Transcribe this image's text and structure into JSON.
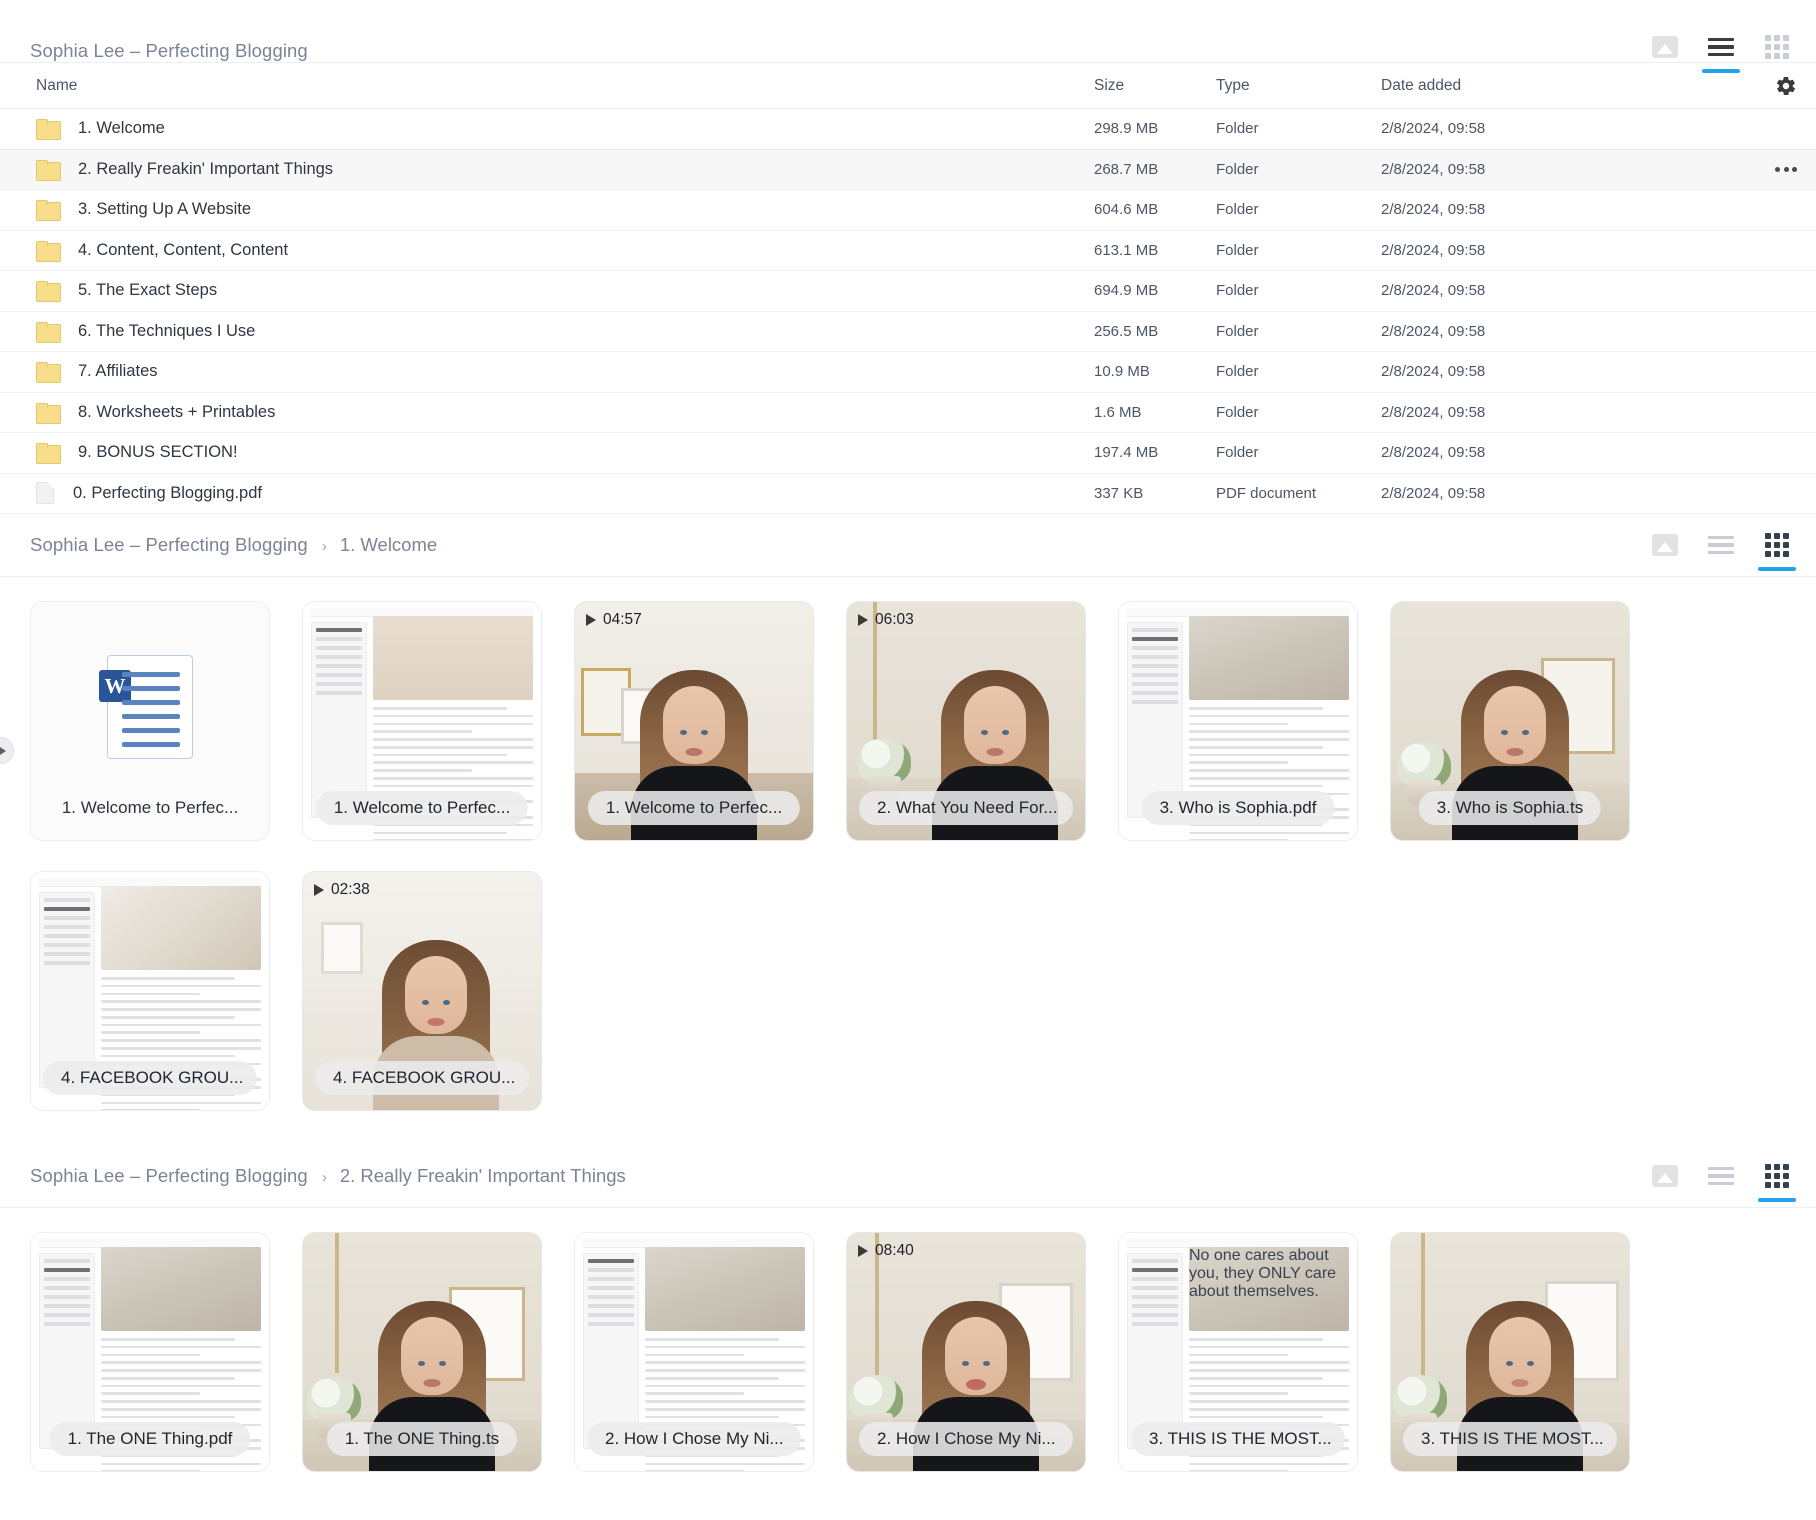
{
  "course": {
    "title": "Sophia Lee – Perfecting Blogging"
  },
  "viewmodes": {
    "gallery_label": "Gallery view",
    "list_label": "List view",
    "grid_label": "Grid view"
  },
  "filelist": {
    "columns": {
      "name": "Name",
      "size": "Size",
      "type": "Type",
      "date_added": "Date added"
    },
    "sort": {
      "column": "Name",
      "direction": "asc"
    },
    "settings_icon": "gear-icon",
    "rows": [
      {
        "name": "1. Welcome",
        "size": "298.9 MB",
        "type": "Folder",
        "date": "2/8/2024, 09:58",
        "kind": "folder",
        "selected": false
      },
      {
        "name": "2. Really Freakin' Important Things",
        "size": "268.7 MB",
        "type": "Folder",
        "date": "2/8/2024, 09:58",
        "kind": "folder",
        "selected": true
      },
      {
        "name": "3. Setting Up A Website",
        "size": "604.6 MB",
        "type": "Folder",
        "date": "2/8/2024, 09:58",
        "kind": "folder",
        "selected": false
      },
      {
        "name": "4. Content, Content, Content",
        "size": "613.1 MB",
        "type": "Folder",
        "date": "2/8/2024, 09:58",
        "kind": "folder",
        "selected": false
      },
      {
        "name": "5. The Exact Steps",
        "size": "694.9 MB",
        "type": "Folder",
        "date": "2/8/2024, 09:58",
        "kind": "folder",
        "selected": false
      },
      {
        "name": "6. The Techniques I Use",
        "size": "256.5 MB",
        "type": "Folder",
        "date": "2/8/2024, 09:58",
        "kind": "folder",
        "selected": false
      },
      {
        "name": "7. Affiliates",
        "size": "10.9 MB",
        "type": "Folder",
        "date": "2/8/2024, 09:58",
        "kind": "folder",
        "selected": false
      },
      {
        "name": "8. Worksheets + Printables",
        "size": "1.6 MB",
        "type": "Folder",
        "date": "2/8/2024, 09:58",
        "kind": "folder",
        "selected": false
      },
      {
        "name": "9. BONUS SECTION!",
        "size": "197.4 MB",
        "type": "Folder",
        "date": "2/8/2024, 09:58",
        "kind": "folder",
        "selected": false
      },
      {
        "name": "0. Perfecting Blogging.pdf",
        "size": "337 KB",
        "type": "PDF document",
        "date": "2/8/2024, 09:58",
        "kind": "pdf",
        "selected": false
      }
    ]
  },
  "section_welcome": {
    "breadcrumb_root": "Sophia Lee – Perfecting Blogging",
    "breadcrumb_sep": "›",
    "breadcrumb_current": "1. Welcome",
    "items": [
      {
        "label": "1. Welcome to Perfec...",
        "kind": "word",
        "duration": ""
      },
      {
        "label": "1. Welcome to Perfec...",
        "kind": "doc",
        "duration": ""
      },
      {
        "label": "1. Welcome to Perfec...",
        "kind": "video",
        "duration": "04:57"
      },
      {
        "label": "2. What You Need For...",
        "kind": "video",
        "duration": "06:03"
      },
      {
        "label": "3. Who is Sophia.pdf",
        "kind": "doc",
        "duration": ""
      },
      {
        "label": "3. Who is Sophia.ts",
        "kind": "video",
        "duration": ""
      },
      {
        "label": "4. FACEBOOK GROU...",
        "kind": "doc",
        "duration": ""
      },
      {
        "label": "4. FACEBOOK GROU...",
        "kind": "video",
        "duration": "02:38"
      }
    ]
  },
  "section_important": {
    "breadcrumb_root": "Sophia Lee – Perfecting Blogging",
    "breadcrumb_sep": "›",
    "breadcrumb_current": "2. Really Freakin' Important Things",
    "items": [
      {
        "label": "1. The ONE Thing.pdf",
        "kind": "doc",
        "duration": ""
      },
      {
        "label": "1. The ONE Thing.ts",
        "kind": "video",
        "duration": ""
      },
      {
        "label": "2. How I Chose My Ni...",
        "kind": "doc",
        "duration": ""
      },
      {
        "label": "2. How I Chose My Ni...",
        "kind": "video",
        "duration": "08:40"
      },
      {
        "label": "3. THIS IS THE MOST...",
        "kind": "doc",
        "duration": "",
        "overlay_caption": "No one cares about you, they ONLY care about themselves."
      },
      {
        "label": "3. THIS IS THE MOST...",
        "kind": "video",
        "duration": ""
      }
    ]
  },
  "colors": {
    "accent": "#22a2e8",
    "folder": "#f8dd8a",
    "text_muted": "#7b8494"
  }
}
